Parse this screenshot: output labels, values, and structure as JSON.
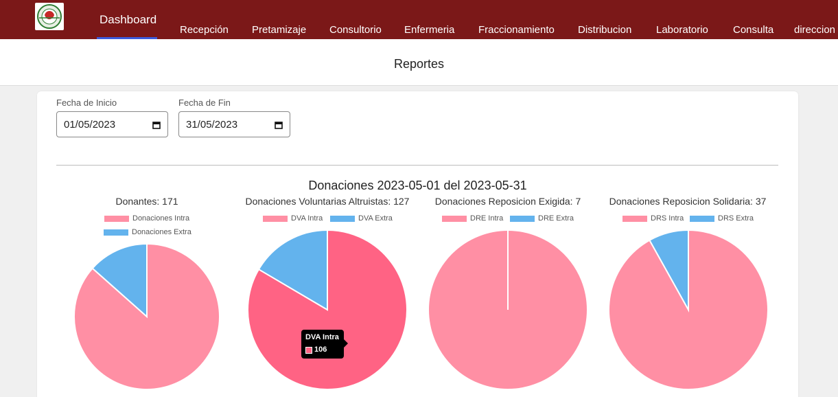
{
  "nav": {
    "items": [
      "Dashboard",
      "Recepción",
      "Pretamizaje",
      "Consultorio",
      "Enfermeria",
      "Fraccionamiento",
      "Distribucion",
      "Laboratorio",
      "Consulta",
      "direccion"
    ],
    "active": "Dashboard"
  },
  "page": {
    "title": "Reportes"
  },
  "filters": {
    "start_label": "Fecha de Inicio",
    "start_value": "01/05/2023",
    "end_label": "Fecha de Fin",
    "end_value": "31/05/2023"
  },
  "report": {
    "title": "Donaciones 2023-05-01 del 2023-05-31"
  },
  "colors": {
    "nav_bg": "#7b1818",
    "intra": "#ff6384",
    "extra": "#63b3ed",
    "active_underline": "#3b5bdb"
  },
  "chart_data": [
    {
      "type": "pie",
      "title": "Donantes: 171",
      "legend": [
        "Donaciones Intra",
        "Donaciones Extra"
      ],
      "values": [
        148,
        23
      ]
    },
    {
      "type": "pie",
      "title": "Donaciones Voluntarias Altruistas: 127",
      "legend": [
        "DVA Intra",
        "DVA Extra"
      ],
      "values": [
        106,
        21
      ]
    },
    {
      "type": "pie",
      "title": "Donaciones Reposicion Exigida: 7",
      "legend": [
        "DRE Intra",
        "DRE Extra"
      ],
      "values": [
        7,
        0
      ]
    },
    {
      "type": "pie",
      "title": "Donaciones Reposicion Solidaria: 37",
      "legend": [
        "DRS Intra",
        "DRS Extra"
      ],
      "values": [
        34,
        3
      ]
    }
  ],
  "tooltip": {
    "label": "DVA Intra",
    "value": "106"
  }
}
